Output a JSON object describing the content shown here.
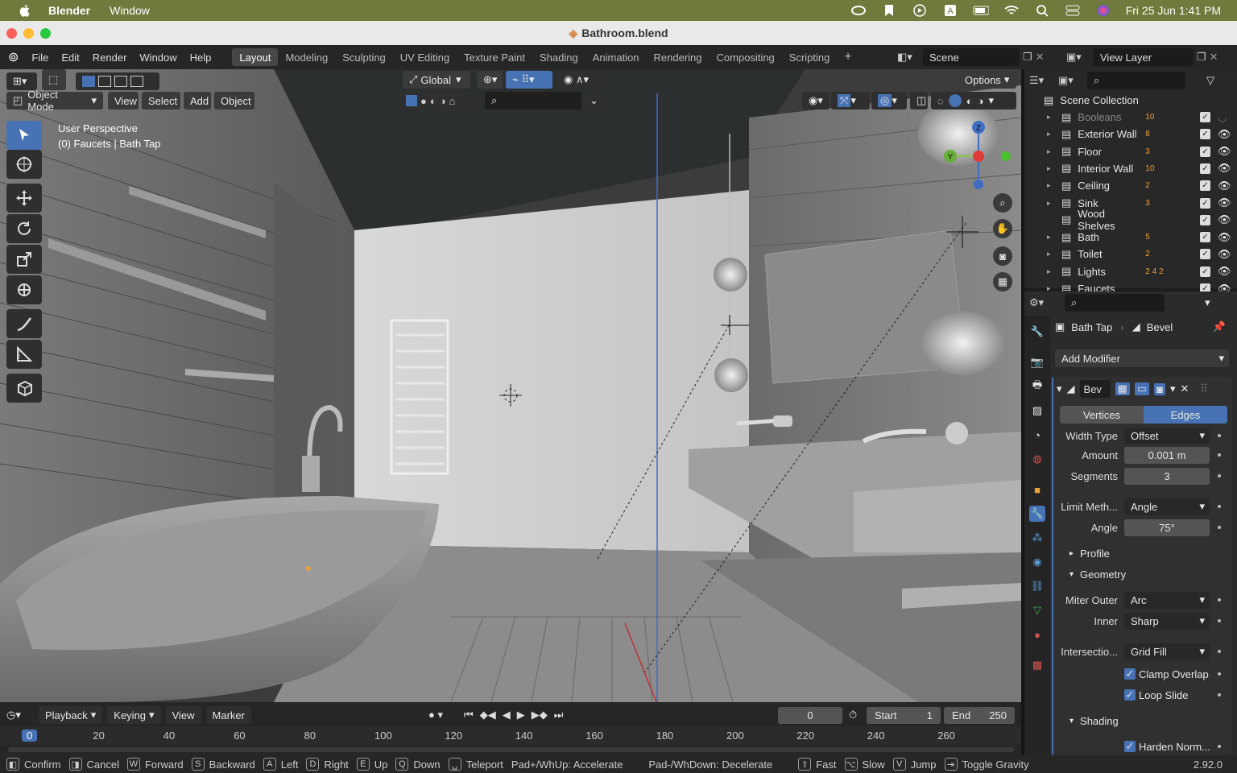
{
  "macos": {
    "app_name": "Blender",
    "menu_window": "Window",
    "datetime": "Fri 25 Jun  1:41 PM"
  },
  "window": {
    "title": "Bathroom.blend"
  },
  "menu": {
    "file": "File",
    "edit": "Edit",
    "render": "Render",
    "window": "Window",
    "help": "Help"
  },
  "workspaces": [
    "Layout",
    "Modeling",
    "Sculpting",
    "UV Editing",
    "Texture Paint",
    "Shading",
    "Animation",
    "Rendering",
    "Compositing",
    "Scripting"
  ],
  "scene": {
    "name": "Scene",
    "view_layer": "View Layer"
  },
  "viewport": {
    "mode": "Object Mode",
    "view": "View",
    "select": "Select",
    "add": "Add",
    "object": "Object",
    "transform": "Global",
    "options": "Options",
    "overlay_line1": "User Perspective",
    "overlay_line2": "(0) Faucets | Bath Tap"
  },
  "outliner": {
    "root": "Scene Collection",
    "items": [
      {
        "name": "Booleans",
        "badge": "10"
      },
      {
        "name": "Exterior Wall",
        "badge": "8"
      },
      {
        "name": "Floor",
        "badge": "3"
      },
      {
        "name": "Interior Wall",
        "badge": "10"
      },
      {
        "name": "Ceiling",
        "badge": "2"
      },
      {
        "name": "Sink",
        "badge": "3"
      },
      {
        "name": "Wood Shelves",
        "badge": ""
      },
      {
        "name": "Bath",
        "badge": "5"
      },
      {
        "name": "Toilet",
        "badge": "2"
      },
      {
        "name": "Lights",
        "badge": "2  4  2"
      },
      {
        "name": "Faucets",
        "badge": ""
      }
    ]
  },
  "properties": {
    "object": "Bath Tap",
    "modifier_name": "Bevel",
    "add_modifier": "Add Modifier",
    "mod_short": "Bev",
    "vertices": "Vertices",
    "edges": "Edges",
    "width_type_label": "Width Type",
    "width_type": "Offset",
    "amount_label": "Amount",
    "amount": "0.001 m",
    "segments_label": "Segments",
    "segments": "3",
    "limit_label": "Limit Meth...",
    "limit": "Angle",
    "angle_label": "Angle",
    "angle": "75°",
    "profile": "Profile",
    "geometry": "Geometry",
    "miter_outer_label": "Miter Outer",
    "miter_outer": "Arc",
    "inner_label": "Inner",
    "inner": "Sharp",
    "intersection_label": "Intersectio...",
    "intersection": "Grid Fill",
    "clamp": "Clamp Overlap",
    "loop": "Loop Slide",
    "shading": "Shading",
    "harden": "Harden Norm..."
  },
  "timeline": {
    "playback": "Playback",
    "keying": "Keying",
    "view": "View",
    "marker": "Marker",
    "current_frame": "0",
    "start_label": "Start",
    "start": "1",
    "end_label": "End",
    "end": "250",
    "ruler": [
      "0",
      "20",
      "40",
      "60",
      "80",
      "100",
      "120",
      "140",
      "160",
      "180",
      "200",
      "220",
      "240",
      "260"
    ]
  },
  "status": {
    "confirm": "Confirm",
    "cancel": "Cancel",
    "forward": "Forward",
    "backward": "Backward",
    "left": "Left",
    "right": "Right",
    "up": "Up",
    "down": "Down",
    "teleport": "Teleport",
    "accel": "Pad+/WhUp: Accelerate",
    "decel": "Pad-/WhDown: Decelerate",
    "fast": "Fast",
    "slow": "Slow",
    "jump": "Jump",
    "gravity": "Toggle Gravity",
    "version": "2.92.0"
  },
  "colors": {
    "accent": "#4772b3",
    "mac_bar": "#6f7a3c",
    "mesh_badge": "#e8a23b"
  }
}
